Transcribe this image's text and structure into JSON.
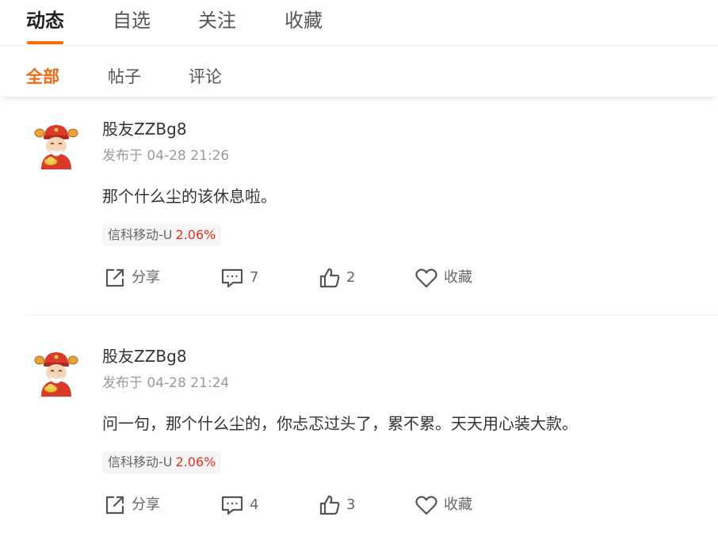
{
  "top_tabs": [
    {
      "label": "动态",
      "active": true
    },
    {
      "label": "自选",
      "active": false
    },
    {
      "label": "关注",
      "active": false
    },
    {
      "label": "收藏",
      "active": false
    }
  ],
  "sub_tabs": [
    {
      "label": "全部",
      "active": true
    },
    {
      "label": "帖子",
      "active": false
    },
    {
      "label": "评论",
      "active": false
    }
  ],
  "colors": {
    "accent": "#ff6a00",
    "accent_text": "#f06a18",
    "stock_up": "#e0301e"
  },
  "posts": [
    {
      "avatar_icon": "fortune-god-avatar-icon",
      "username": "股友ZZBg8",
      "time": "发布于 04-28 21:26",
      "text": "那个什么尘的该休息啦。",
      "stock_tag": {
        "name": "信科移动-U",
        "change": "2.06%"
      },
      "actions": {
        "share_label": "分享",
        "comment_count": "7",
        "like_count": "2",
        "favorite_label": "收藏"
      }
    },
    {
      "avatar_icon": "fortune-god-avatar-icon",
      "username": "股友ZZBg8",
      "time": "发布于 04-28 21:24",
      "text": "问一句，那个什么尘的，你忐忑过头了，累不累。天天用心装大款。",
      "stock_tag": {
        "name": "信科移动-U",
        "change": "2.06%"
      },
      "actions": {
        "share_label": "分享",
        "comment_count": "4",
        "like_count": "3",
        "favorite_label": "收藏"
      }
    }
  ]
}
